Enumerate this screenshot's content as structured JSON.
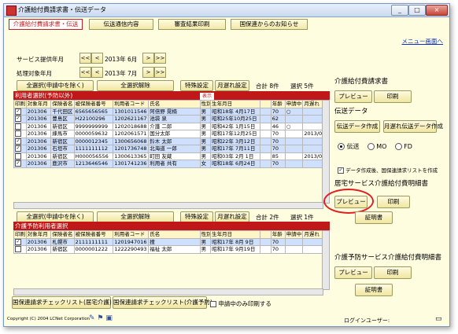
{
  "window": {
    "title": "介護給付費請求書・伝送データ",
    "min": "_",
    "max": "□",
    "close": "×"
  },
  "tabs": [
    {
      "label": "介護給付費請求書・伝送"
    },
    {
      "label": "伝送通信内容"
    },
    {
      "label": "審査結果印刷"
    },
    {
      "label": "国保連からのお知らせ"
    }
  ],
  "menu_link": "メニュー画面へ",
  "period": {
    "service_label": "サービス提供年月",
    "service_value": "2013年 6月",
    "process_label": "処理対象年月",
    "process_value": "2013年 7月",
    "nav_prev2": "<<",
    "nav_prev": "<",
    "nav_next": ">",
    "nav_next2": ">>"
  },
  "care_section": {
    "select_all": "全選択(申請中を除く)",
    "deselect_all": "全選択解除",
    "special": "特殊設定",
    "late": "月遅れ設定",
    "total": "合計 8件",
    "selected": "選択 5件",
    "header": "利用者選択(予防以外)",
    "header_tag": "表示",
    "columns": [
      "印刷",
      "対象年月",
      "保険者名",
      "被保険者番号",
      "利用者コード",
      "氏名",
      "性別",
      "生年月日",
      "",
      "年齢",
      "申請中",
      "月遅れ"
    ],
    "rows": [
      {
        "check": true,
        "ym": "201306",
        "insurer": "千代田区",
        "no": "6565656565",
        "code": "1301011546",
        "name": "阿倍野 晃楠",
        "sex": "男",
        "birth": "昭和18年 4月17日",
        "age": "70",
        "app": "○",
        "late": ""
      },
      {
        "check": true,
        "ym": "201306",
        "insurer": "豊島区",
        "no": "H22100296",
        "code": "1202621167",
        "name": "池袋 泉",
        "sex": "男",
        "birth": "昭和25年10月25日",
        "age": "62",
        "app": "",
        "late": ""
      },
      {
        "check": false,
        "ym": "201306",
        "insurer": "新宿区",
        "no": "9999999999",
        "code": "1202018688",
        "name": "介護 二郎",
        "sex": "男",
        "birth": "昭和42年 1月15日",
        "age": "46",
        "app": "○",
        "late": ""
      },
      {
        "check": false,
        "ym": "201306",
        "insurer": "練馬市",
        "no": "0000059632",
        "code": "1202061571",
        "name": "国分太郎",
        "sex": "男",
        "birth": "昭和17年12月25日",
        "age": "70",
        "app": "",
        "late": "2013/0"
      },
      {
        "check": true,
        "ym": "201306",
        "insurer": "新宿区",
        "no": "0000012345",
        "code": "1300656068",
        "name": "鈴木 太郎",
        "sex": "男",
        "birth": "昭和22年 3月12日",
        "age": "70",
        "app": "",
        "late": ""
      },
      {
        "check": true,
        "ym": "201306",
        "insurer": "石垣市",
        "no": "1111111112",
        "code": "1201736748",
        "name": "北海道 一郎",
        "sex": "男",
        "birth": "昭和17年 7月11日",
        "age": "70",
        "app": "",
        "late": ""
      },
      {
        "check": false,
        "ym": "201306",
        "insurer": "新宿区",
        "no": "H000056556",
        "code": "1300613365",
        "name": "町田 友蔵",
        "sex": "男",
        "birth": "昭和03年 2月 1日",
        "age": "85",
        "app": "",
        "late": "2013/0"
      },
      {
        "check": true,
        "ym": "201306",
        "insurer": "鹿沢市",
        "no": "1213646546",
        "code": "1301741236",
        "name": "利用者 共有",
        "sex": "女",
        "birth": "昭和18年 6月24日",
        "age": "70",
        "app": "",
        "late": ""
      }
    ]
  },
  "prev_section": {
    "select_all": "全選択(申請中を除く)",
    "deselect_all": "全選択解除",
    "special": "特殊設定",
    "late": "月遅れ設定",
    "total": "合計 2件",
    "selected": "選択 1件",
    "header": "介護予防利用者選択",
    "columns": [
      "印刷",
      "対象年月",
      "保険者名",
      "被保険者番号",
      "利用者コード",
      "氏名",
      "性別",
      "生年月日",
      "",
      "年齢",
      "申請中",
      "月遅れ"
    ],
    "rows": [
      {
        "check": true,
        "ym": "201306",
        "insurer": "札幌市",
        "no": "2111111111",
        "code": "1201947016",
        "name": "捜",
        "sex": "男",
        "birth": "昭和17年 8月 9日",
        "age": "70",
        "app": "",
        "late": ""
      },
      {
        "check": false,
        "ym": "201306",
        "insurer": "新宿区",
        "no": "0000001222",
        "code": "1222290493",
        "name": "福祉 太郎",
        "sex": "男",
        "birth": "昭和17年 9月19日",
        "age": "70",
        "app": "",
        "late": ""
      }
    ]
  },
  "bottom": {
    "check_btn1": "国保連請求チェックリスト(居宅介護)",
    "check_btn2": "国保連請求チェックリスト(介護予防)",
    "only_applying": "申請中のみ印刷する",
    "copyright": "Copyright (C) 2004 LCNet Corporation",
    "login": "ログインユーザー:"
  },
  "right": {
    "claim_title": "介護給付費請求書",
    "preview": "プレビュー",
    "print": "印刷",
    "transmit_title": "伝送データ",
    "create_transmit": "伝送データ作成",
    "create_late": "月遅れ伝送データ作成",
    "radio_transmit": "伝送",
    "radio_mo": "MO",
    "radio_fd": "FD",
    "create_list": "データ作成後、国保連請求リストを作成",
    "home_title": "居宅サービス介護給付費明細書",
    "home_preview": "プレビュー",
    "home_print": "印刷",
    "home_cert": "証明書",
    "prev_title": "介護予防サービス介護給付費明細書",
    "prev_preview": "プレビュー",
    "prev_print": "印刷",
    "prev_cert": "証明書"
  }
}
